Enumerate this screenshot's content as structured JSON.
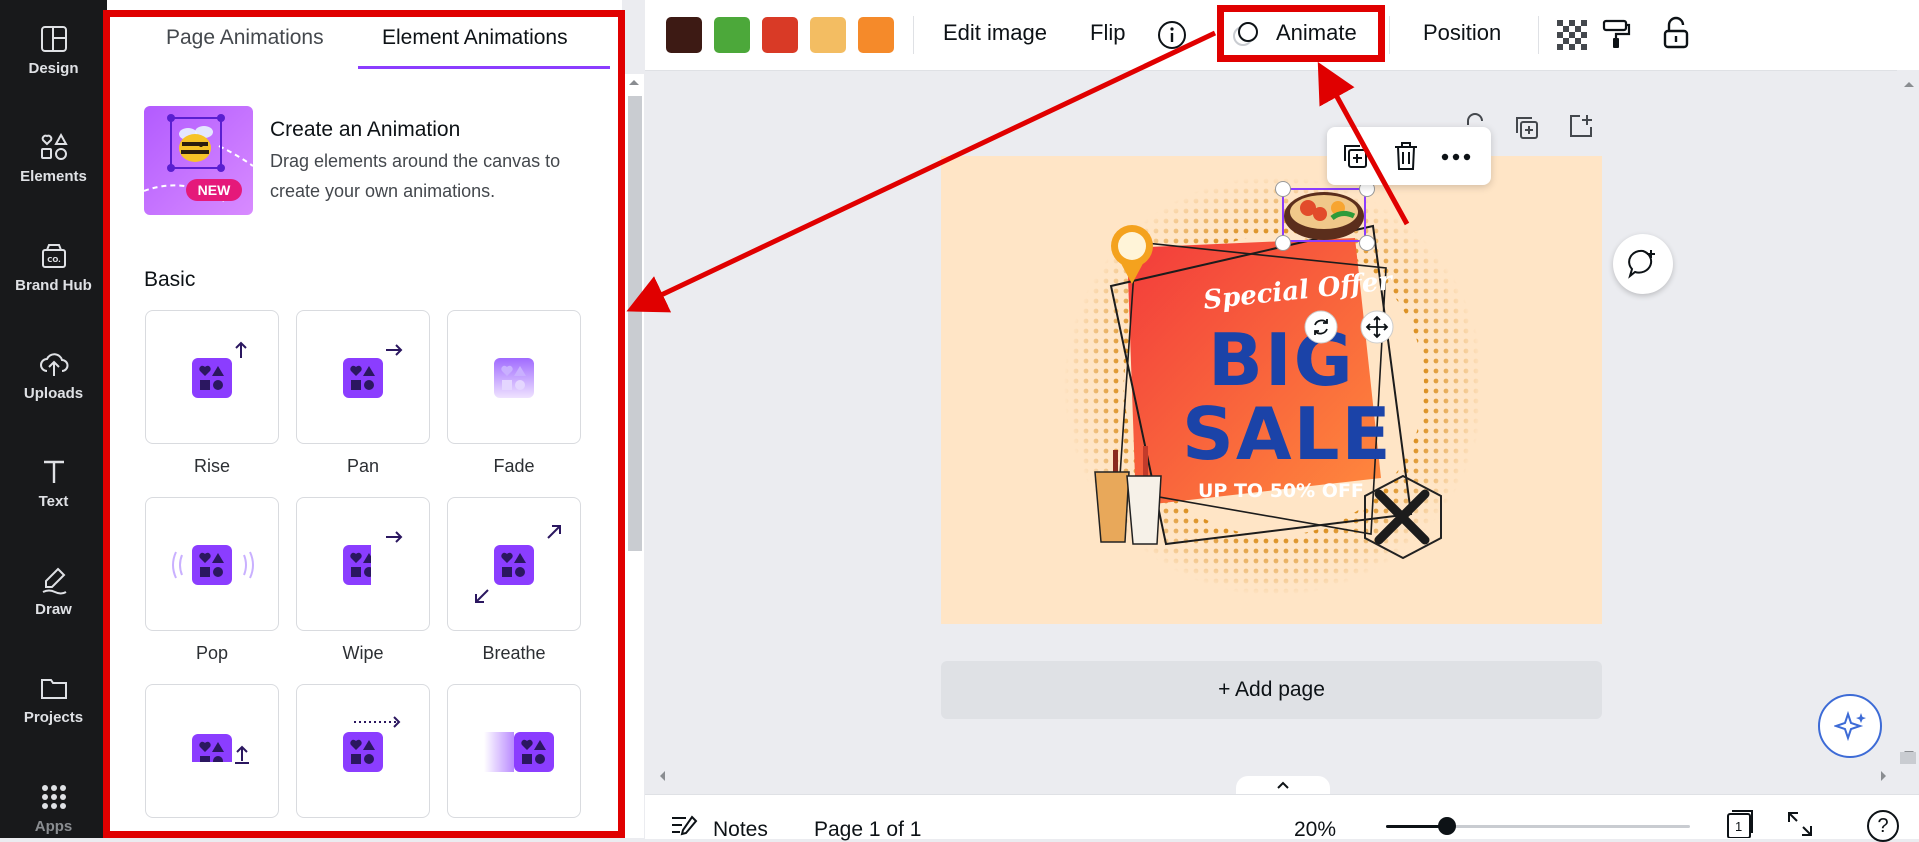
{
  "rail": {
    "items": [
      {
        "label": "Design",
        "icon": "design-icon"
      },
      {
        "label": "Elements",
        "icon": "elements-icon"
      },
      {
        "label": "Brand Hub",
        "icon": "brand-hub-icon"
      },
      {
        "label": "Uploads",
        "icon": "uploads-icon"
      },
      {
        "label": "Text",
        "icon": "text-icon"
      },
      {
        "label": "Draw",
        "icon": "draw-icon"
      },
      {
        "label": "Projects",
        "icon": "projects-icon"
      },
      {
        "label": "Apps",
        "icon": "apps-icon"
      }
    ]
  },
  "panel": {
    "tabs": [
      {
        "label": "Page Animations",
        "active": false
      },
      {
        "label": "Element Animations",
        "active": true
      }
    ],
    "promo": {
      "title": "Create an Animation",
      "description_line1": "Drag elements around the canvas to",
      "description_line2": "create your own animations.",
      "badge": "NEW"
    },
    "section_title": "Basic",
    "animations": [
      {
        "label": "Rise"
      },
      {
        "label": "Pan"
      },
      {
        "label": "Fade"
      },
      {
        "label": "Pop"
      },
      {
        "label": "Wipe"
      },
      {
        "label": "Breathe"
      },
      {
        "label": ""
      },
      {
        "label": ""
      },
      {
        "label": ""
      }
    ]
  },
  "toolbar": {
    "swatches": [
      "#3d1a14",
      "#4ca83a",
      "#d93a26",
      "#f3bd62",
      "#f58a2a"
    ],
    "edit_image": "Edit image",
    "flip": "Flip",
    "animate": "Animate",
    "position": "Position"
  },
  "canvas": {
    "headline_script": "Special Offer",
    "headline_big": "BIG",
    "headline_sale": "SALE",
    "subline": "UP TO 50% OFF",
    "add_page": "+ Add page"
  },
  "bottom": {
    "notes": "Notes",
    "page_indicator": "Page 1 of 1",
    "zoom": "20%",
    "zoom_fraction": 0.2,
    "page_count": "1",
    "help": "?"
  },
  "colors": {
    "accent": "#8b3dff",
    "highlight": "#e00000"
  }
}
